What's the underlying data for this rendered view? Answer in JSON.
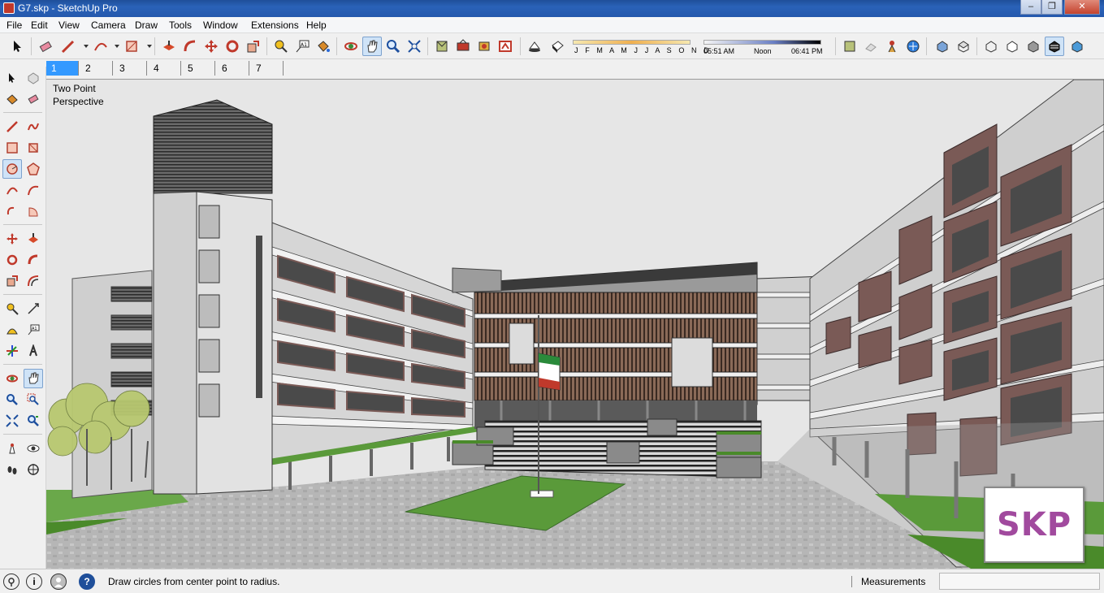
{
  "window": {
    "title": "G7.skp - SketchUp Pro",
    "minimize_label": "–",
    "maximize_label": "❐",
    "close_label": "✕"
  },
  "menu": {
    "items": [
      "File",
      "Edit",
      "View",
      "Camera",
      "Draw",
      "Tools",
      "Window",
      "Extensions",
      "Help"
    ]
  },
  "toolbar": {
    "months_label": "J F M A M J J A S O N D",
    "time_start": "05:51 AM",
    "time_mid": "Noon",
    "time_end": "06:41 PM"
  },
  "scenes": {
    "tabs": [
      "1",
      "2",
      "3",
      "4",
      "5",
      "6",
      "7"
    ],
    "active_index": 0
  },
  "viewport": {
    "camera_label_line1": "Two Point",
    "camera_label_line2": "Perspective",
    "watermark": "SKP"
  },
  "status": {
    "message": "Draw circles from center point to radius.",
    "measurements_label": "Measurements",
    "measurements_value": "",
    "help_icon_label": "?",
    "info_icon_label": "i"
  },
  "colors": {
    "titlebar": "#2458ad",
    "active_scene_tab": "#3399ff",
    "watermark_text": "#a14a9e",
    "facade_panel": "#7a5a56",
    "lawn": "#5a9a3a",
    "paving": "#b6b6b6"
  }
}
